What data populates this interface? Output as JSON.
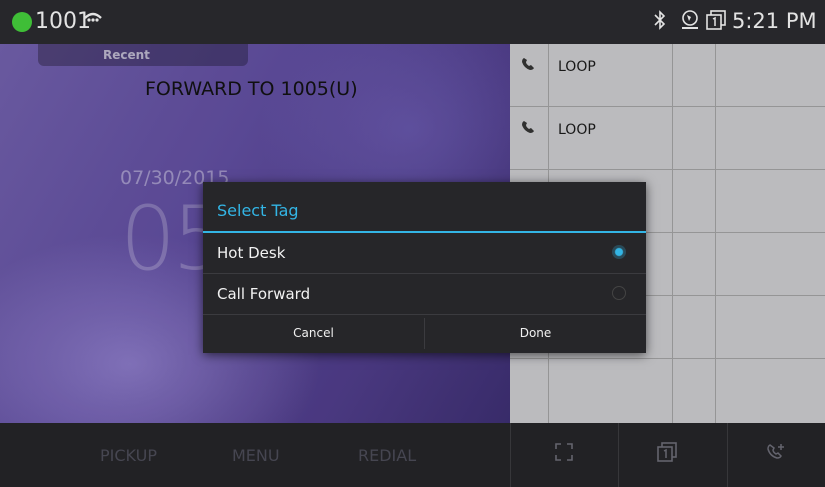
{
  "status_bar": {
    "extension": "1001",
    "time": "5:21 PM",
    "status_color": "#43c93a",
    "icons": [
      "voicemail-icon",
      "bluetooth-icon",
      "network-icon",
      "line-status-icon"
    ]
  },
  "idle": {
    "tab_label": "Recent",
    "forward_text": "FORWARD TO 1005(U)",
    "date": "07/30/2015",
    "clock": "05"
  },
  "line_keys": [
    {
      "label": "LOOP",
      "icon": "phone-icon"
    },
    {
      "label": "LOOP",
      "icon": "phone-icon"
    },
    {
      "label": "",
      "icon": ""
    },
    {
      "label": "",
      "icon": ""
    },
    {
      "label": "",
      "icon": ""
    },
    {
      "label": "",
      "icon": ""
    }
  ],
  "softkeys": [
    "PICKUP",
    "MENU",
    "REDIAL"
  ],
  "bottom_icons": [
    "fullscreen-icon",
    "line-status-icon",
    "new-call-icon"
  ],
  "dialog": {
    "title": "Select Tag",
    "options": [
      {
        "label": "Hot Desk",
        "selected": true
      },
      {
        "label": "Call Forward",
        "selected": false
      }
    ],
    "cancel_label": "Cancel",
    "done_label": "Done",
    "accent_color": "#33b5e5"
  }
}
